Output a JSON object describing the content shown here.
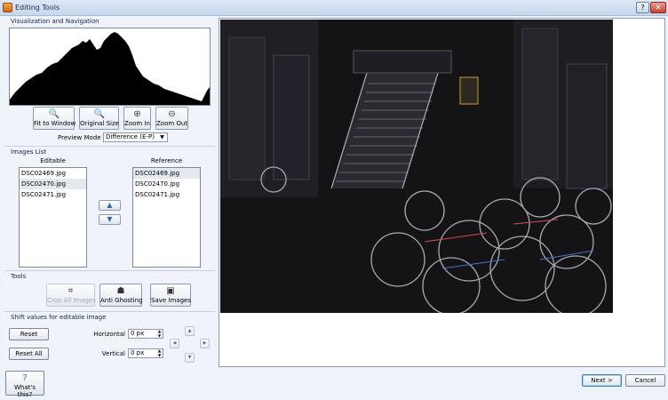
{
  "window": {
    "title": "Editing Tools",
    "help_label": "?",
    "close_label": "✕"
  },
  "visualization": {
    "group_title": "Visualization and Navigation",
    "buttons": {
      "fit": "Fit to Window",
      "original": "Original Size",
      "zoom_in": "Zoom In",
      "zoom_out": "Zoom Out"
    },
    "preview_mode_label": "Preview Mode",
    "preview_mode_value": "Difference (E-P)"
  },
  "images_list": {
    "group_title": "Images List",
    "editable_header": "Editable",
    "reference_header": "Reference",
    "editable": [
      "DSC02469.jpg",
      "DSC02470.jpg",
      "DSC02471.jpg"
    ],
    "reference": [
      "DSC02469.jpg",
      "DSC02470.jpg",
      "DSC02471.jpg"
    ],
    "editable_selected_index": 1,
    "reference_selected_index": 0
  },
  "tools": {
    "group_title": "Tools",
    "crop": "Crop All Images",
    "anti_ghosting": "Anti Ghosting",
    "save": "Save Images"
  },
  "shift": {
    "group_title": "Shift values for editable image",
    "reset": "Reset",
    "reset_all": "Reset All",
    "horizontal_label": "Horizontal",
    "horizontal_value": "0 px",
    "vertical_label": "Vertical",
    "vertical_value": "0 px"
  },
  "footer": {
    "whats_this": "What's this?",
    "next": "Next >",
    "cancel": "Cancel"
  },
  "icons": {
    "app": "app-icon",
    "fit": "magnifier-icon",
    "original": "magnifier-icon",
    "zoom_in": "zoom-in-icon",
    "zoom_out": "zoom-out-icon",
    "up": "arrow-up-icon",
    "down": "arrow-down-icon",
    "crop": "crop-icon",
    "anti_ghosting": "ghost-icon",
    "save": "floppy-icon",
    "help": "help-icon"
  },
  "colors": {
    "accent": "#2d6fb8",
    "title_bar": "#c6d6ee",
    "photo_bg": "#141416"
  }
}
